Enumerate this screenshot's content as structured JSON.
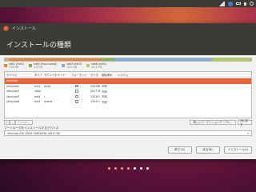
{
  "window": {
    "title": "インストール"
  },
  "page": {
    "title": "インストールの種類"
  },
  "disk_bar": {
    "segments": [
      {
        "name": "free",
        "color": "#d2b27a",
        "fraction": 0.015
      },
      {
        "name": "sda1",
        "color": "#e4863c",
        "fraction": 0.375
      },
      {
        "name": "sda5",
        "color": "#87b054",
        "fraction": 0.055
      },
      {
        "name": "sda3",
        "color": "#75b1dc",
        "fraction": 0.395
      },
      {
        "name": "sda6",
        "color": "#b0cf5a",
        "fraction": 0.16
      }
    ]
  },
  "legend": [
    {
      "label": "sda1 (ext4)",
      "size": "126 MB",
      "color": "#e4863c"
    },
    {
      "label": "sda5 (linux-swap)",
      "size": "2.0 GB",
      "color": "#87b054"
    },
    {
      "label": "sda3 (ext4)",
      "size": "13.5 GB",
      "color": "#75b1dc"
    },
    {
      "label": "sda6 (ext4)",
      "size": "29.4 GB",
      "color": "#b0cf5a"
    }
  ],
  "table": {
    "headers": [
      "デバイス",
      "タイプ",
      "マウントポイント",
      "フォーマット",
      "サイズ",
      "使用済み",
      "システム"
    ],
    "rows": [
      {
        "device": "/dev/sda",
        "type": "",
        "mount": "",
        "format": false,
        "size": "",
        "used": "",
        "system": "",
        "selected": true
      },
      {
        "device": "/dev/sda1",
        "type": "ext4",
        "mount": "/boot",
        "format": true,
        "size": "126 MB",
        "used": "不明",
        "system": ""
      },
      {
        "device": "/dev/sda5",
        "type": "swap",
        "mount": "",
        "format": true,
        "size": "2047 MB",
        "used": "不明",
        "system": ""
      },
      {
        "device": "/dev/sda3",
        "type": "ext4",
        "mount": "/",
        "format": true,
        "size": "13538 MB",
        "used": "不明",
        "system": ""
      },
      {
        "device": "/dev/sda6",
        "type": "ext4",
        "mount": "/home",
        "format": true,
        "size": "29435 MB",
        "used": "不明",
        "system": ""
      }
    ]
  },
  "toolbar": {
    "add": "+",
    "remove": "-",
    "change": "Change...",
    "new_table": "新しいパーティションテーブル...",
    "revert": "元に戻す"
  },
  "boot": {
    "label": "ブートローダをインストールするデバイス:",
    "value": "/dev/sda   ATA VBOX HARDDISK (48.8 GB)"
  },
  "actions": {
    "quit": "終了(Q)",
    "back": "戻る(B)",
    "install": "インストール(I)"
  },
  "progress_dots": [
    {
      "color": "#f0a070"
    },
    {
      "color": "#f0a070"
    },
    {
      "color": "#f0a070"
    },
    {
      "color": "#f0a070"
    },
    {
      "color": "#ffffff"
    },
    {
      "color": "#ffffff"
    },
    {
      "color": "#ffffff"
    }
  ]
}
